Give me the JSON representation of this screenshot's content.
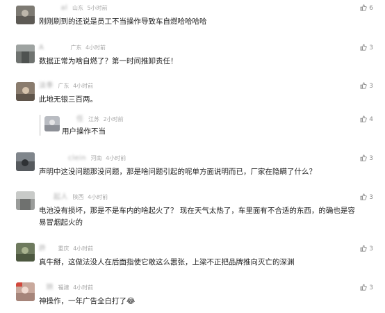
{
  "comments": [
    {
      "username": "   al",
      "location": "山东",
      "time": "5小时前",
      "text": "刚刚刷到的还说是员工不当操作导致车自燃哈哈哈哈",
      "likes": "6",
      "avatar_color": "#7d7a73"
    },
    {
      "username": "A   ",
      "location": "广东",
      "time": "4小时前",
      "text": "数据正常为啥自燃了？第一时间推卸责任！",
      "likes": "3",
      "avatar_color": "#6f7370"
    },
    {
      "username": "淡季",
      "location": "广东",
      "time": "4小时前",
      "text": "此地无银三百两。",
      "likes": "3",
      "avatar_color": "#8a7c6e",
      "reply": {
        "username": "  任",
        "location": "江苏",
        "time": "2小时前",
        "text": "用户操作不当",
        "likes": "4",
        "avatar_color": "#b9bcc2"
      }
    },
    {
      "username": "    clein",
      "location": "河南",
      "time": "4小时前",
      "text": "声明中这没问题那没问题，那是啥问题引起的呢单方面说明而已，厂家在隐瞒了什么？",
      "likes": "3",
      "avatar_color": "#565a5e"
    },
    {
      "username": "  起人",
      "location": "陕西",
      "time": "4小时前",
      "text_lines": [
        "电池没有损坏，那是不是车内的啥起火了？ 现在天气太热了，车里面有不合适的东西，的确也是容",
        "易冒烟起火的"
      ],
      "likes": "3",
      "avatar_color": "#9a9c9a"
    },
    {
      "username": "許 ",
      "location": "重庆",
      "time": "4小时前",
      "text": "真牛掰，这做法没人在后面指使它敢这么嚣张，上梁不正把品牌推向灭亡的深渊",
      "likes": "3",
      "avatar_color": "#6e7a5e"
    },
    {
      "username": " 珙",
      "location": "福建",
      "time": "4小时前",
      "text": "神操作，一年广告全白打了😂",
      "likes": "3",
      "avatar_color": "#c9a99d"
    }
  ]
}
